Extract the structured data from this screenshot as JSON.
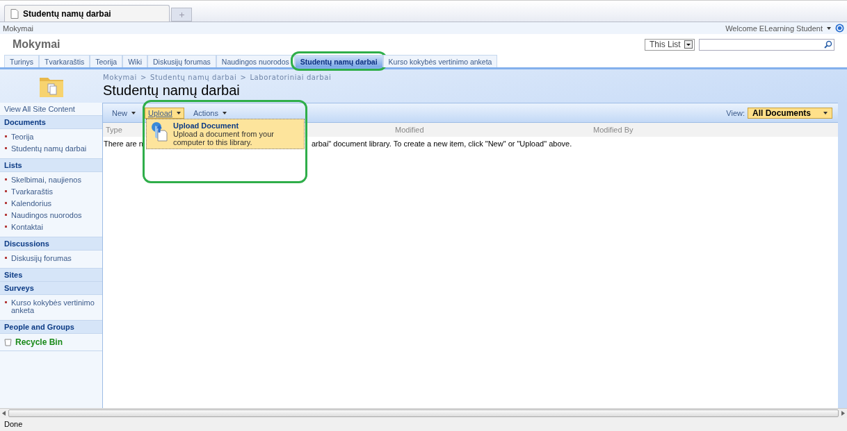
{
  "browser_tab": {
    "title": "Studentų namų darbai"
  },
  "site_bar": {
    "site_link": "Mokymai",
    "welcome": "Welcome ELearning Student"
  },
  "site_title": "Mokymai",
  "search": {
    "scope": "This List"
  },
  "tabs": [
    {
      "label": "Turinys",
      "selected": false
    },
    {
      "label": "Tvarkaraštis",
      "selected": false
    },
    {
      "label": "Teorija",
      "selected": false
    },
    {
      "label": "Wiki",
      "selected": false
    },
    {
      "label": "Diskusijų forumas",
      "selected": false
    },
    {
      "label": "Naudingos nuorodos",
      "selected": false
    },
    {
      "label": "Studentų namų darbai",
      "selected": true
    },
    {
      "label": "Kurso kokybės vertinimo anketa",
      "selected": false
    }
  ],
  "breadcrumb": [
    "Mokymai",
    "Studentų namų darbai",
    "Laboratoriniai darbai"
  ],
  "breadcrumb_separator": ">",
  "page_title": "Studentų namų darbai",
  "sidebar": {
    "view_all": "View All Site Content",
    "sections": [
      {
        "title": "Documents",
        "items": [
          "Teorija",
          "Studentų namų darbai"
        ]
      },
      {
        "title": "Lists",
        "items": [
          "Skelbimai, naujienos",
          "Tvarkaraštis",
          "Kalendorius",
          "Naudingos nuorodos",
          "Kontaktai"
        ]
      },
      {
        "title": "Discussions",
        "items": [
          "Diskusijų forumas"
        ]
      },
      {
        "title": "Sites"
      },
      {
        "title": "Surveys",
        "items": [
          "Kurso kokybės vertinimo anketa"
        ]
      },
      {
        "title": "People and Groups"
      }
    ],
    "recycle_bin": "Recycle Bin"
  },
  "toolbar": {
    "items": [
      {
        "label": "New",
        "open": false
      },
      {
        "label": "Upload",
        "open": true
      },
      {
        "label": "Actions",
        "open": false
      }
    ],
    "view_label": "View:",
    "view_value": "All Documents"
  },
  "upload_menu": {
    "title": "Upload Document",
    "description": "Upload a document from your computer to this library."
  },
  "columns": [
    "Type",
    "Modified",
    "Modified By"
  ],
  "message_parts": [
    "There are n",
    "arbai\" document library. To create a new item, click \"New\" or \"Upload\" above."
  ],
  "status": "Done"
}
